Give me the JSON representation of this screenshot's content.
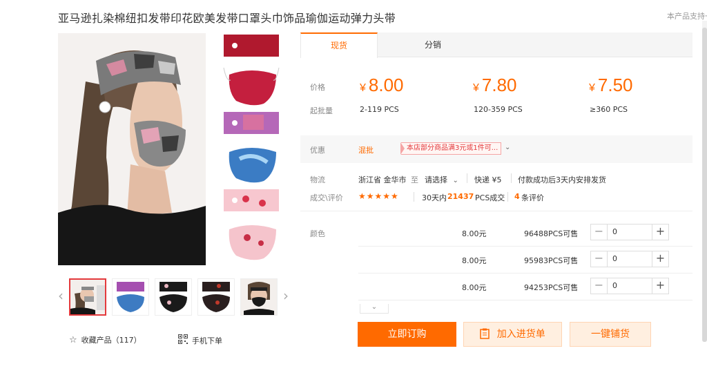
{
  "product": {
    "title": "亚马逊扎染棉纽扣发带印花欧美发带口罩头巾饰品瑜伽运动弹力头带",
    "support_note": "本产品支持一"
  },
  "tabs": [
    {
      "label": "现货",
      "active": true
    },
    {
      "label": "分销",
      "active": false
    }
  ],
  "pricing": {
    "price_label": "价格",
    "qty_label": "起批量",
    "currency": "¥",
    "tiers": [
      {
        "price": "8.00",
        "range": "2-119 PCS"
      },
      {
        "price": "7.80",
        "range": "120-359 PCS"
      },
      {
        "price": "7.50",
        "range": "≥360 PCS"
      }
    ]
  },
  "promo": {
    "label": "优惠",
    "tag": "混批",
    "text": "本店部分商品满3元或1件可...",
    "expand_icon": "chevron-down-icon"
  },
  "logistics": {
    "label": "物流",
    "origin": "浙江省 金华市",
    "to": "至",
    "destination": "请选择",
    "express": "快递 ¥5",
    "shipping_note": "付款成功后3天内安排发货"
  },
  "reviews": {
    "label": "成交\\评价",
    "stars": "★★★★★",
    "rating": 5,
    "deals_prefix": "30天内",
    "deals_count": "21437",
    "deals_suffix": "PCS成交",
    "review_count": "4",
    "review_suffix": "条评价"
  },
  "sku": {
    "color_label": "颜色",
    "rows": [
      {
        "price": "8.00元",
        "stock": "96488PCS可售",
        "qty": "0"
      },
      {
        "price": "8.00元",
        "stock": "95983PCS可售",
        "qty": "0"
      },
      {
        "price": "8.00元",
        "stock": "94253PCS可售",
        "qty": "0"
      }
    ]
  },
  "actions": {
    "buy": "立即订购",
    "add_to_list": "加入进货单",
    "distribute": "一键铺货"
  },
  "footer": {
    "favorite": "收藏产品（117）",
    "mobile_order": "手机下单"
  },
  "colors": {
    "accent": "#ff6a00",
    "promo_red": "#e4393c"
  }
}
